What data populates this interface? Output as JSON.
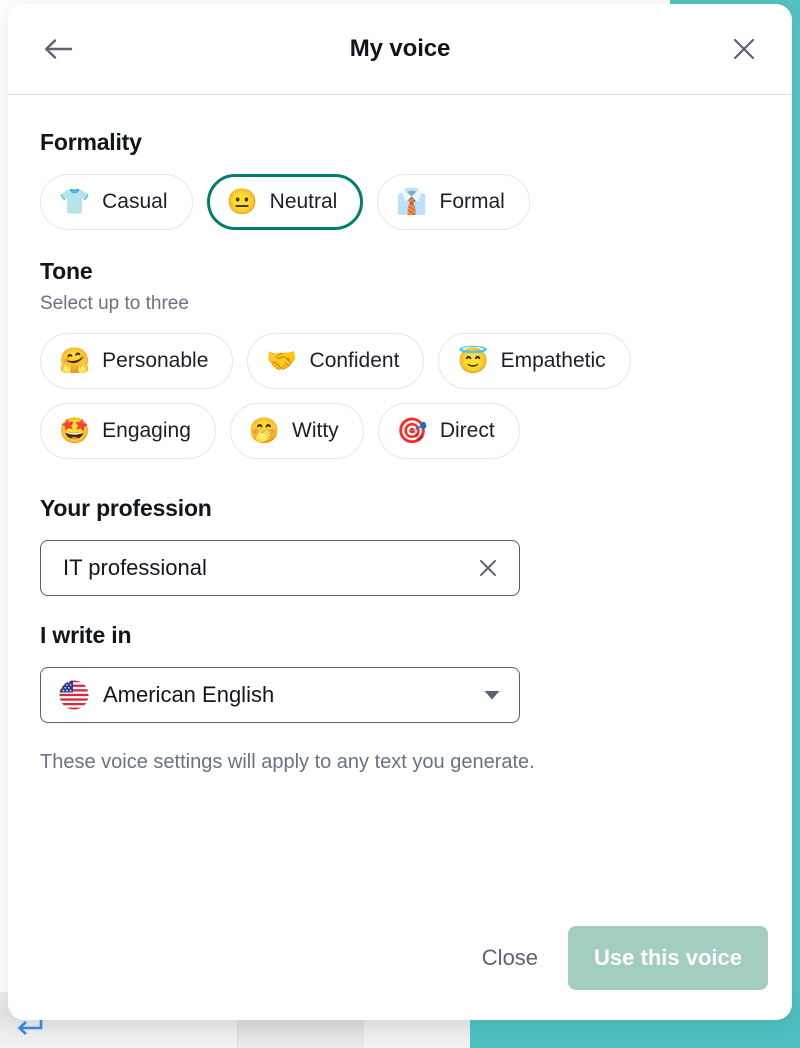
{
  "header": {
    "title": "My voice",
    "back_icon": "arrow-left-icon",
    "close_icon": "close-icon"
  },
  "formality": {
    "title": "Formality",
    "options": [
      {
        "label": "Casual",
        "emoji": "👕",
        "icon": "tshirt-icon",
        "selected": false
      },
      {
        "label": "Neutral",
        "emoji": "😐",
        "icon": "neutral-face-icon",
        "selected": true
      },
      {
        "label": "Formal",
        "emoji": "👔",
        "icon": "dress-shirt-icon",
        "selected": false
      }
    ]
  },
  "tone": {
    "title": "Tone",
    "subtitle": "Select up to three",
    "options": [
      {
        "label": "Personable",
        "emoji": "🤗",
        "icon": "hugging-face-icon",
        "selected": false
      },
      {
        "label": "Confident",
        "emoji": "🤝",
        "icon": "handshake-icon",
        "selected": false
      },
      {
        "label": "Empathetic",
        "emoji": "😇",
        "icon": "halo-face-icon",
        "selected": false
      },
      {
        "label": "Engaging",
        "emoji": "🤩",
        "icon": "star-struck-face-icon",
        "selected": false
      },
      {
        "label": "Witty",
        "emoji": "🤭",
        "icon": "hand-over-mouth-icon",
        "selected": false
      },
      {
        "label": "Direct",
        "emoji": "🎯",
        "icon": "target-icon",
        "selected": false
      }
    ]
  },
  "profession": {
    "title": "Your profession",
    "value": "IT professional",
    "placeholder": "Your profession",
    "clear_icon": "close-icon"
  },
  "language": {
    "title": "I write in",
    "value": "American English",
    "flag_icon": "us-flag-icon",
    "chevron_icon": "chevron-down-icon"
  },
  "helper_text": "These voice settings will apply to any text you generate.",
  "footer": {
    "close_label": "Close",
    "primary_label": "Use this voice"
  },
  "backdrop": {
    "enter_key_icon": "enter-return-arrow-icon"
  },
  "colors": {
    "selected_chip_border": "#00806a",
    "primary_button_disabled": "#a4cdc2",
    "chip_border": "#e4e6eb",
    "field_border": "#5a5f68",
    "muted_text": "#6a7183",
    "title_text": "#11161d",
    "backdrop_teal": "#53c3c3",
    "enter_key_blue": "#3b86e8"
  }
}
